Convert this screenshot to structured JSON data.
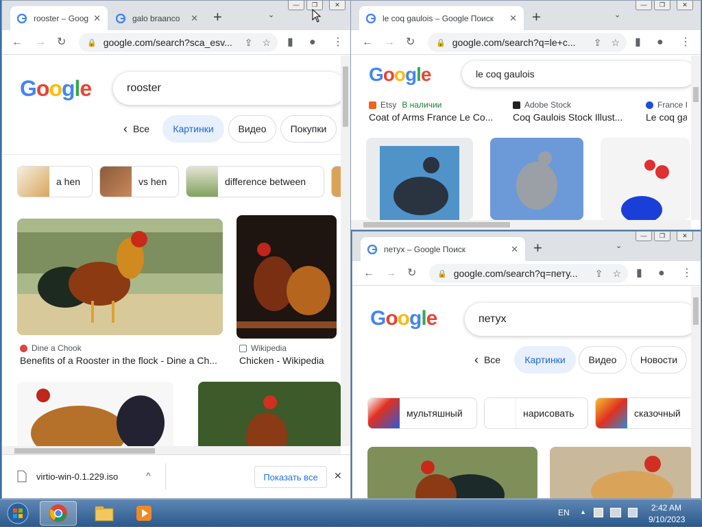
{
  "win1": {
    "tabs": [
      {
        "title": "rooster – Goog",
        "close": "✕"
      },
      {
        "title": "galo braanco",
        "close": "✕"
      }
    ],
    "new_tab": "+",
    "tab_menu": "⌄",
    "url": "google.com/search?sca_esv...",
    "query": "rooster",
    "chips": [
      "Все",
      "Картинки",
      "Видео",
      "Покупки"
    ],
    "related": [
      "a hen",
      "vs hen",
      "difference between"
    ],
    "results": [
      {
        "source": "Dine a Chook",
        "caption": "Benefits of a Rooster in the flock - Dine a Ch..."
      },
      {
        "source": "Wikipedia",
        "caption": "Chicken - Wikipedia"
      }
    ],
    "download": {
      "file": "virtio-win-0.1.229.iso",
      "show_all": "Показать все",
      "expand": "^",
      "close": "✕"
    }
  },
  "win2": {
    "tabs": [
      {
        "title": "le coq gaulois – Google Поиск",
        "close": "✕"
      }
    ],
    "new_tab": "+",
    "tab_menu": "⌄",
    "url": "google.com/search?q=le+c...",
    "query": "le coq gaulois",
    "results": [
      {
        "source": "Etsy",
        "badge": "В наличии",
        "caption": "Coat of Arms France Le Co..."
      },
      {
        "source": "Adobe Stock",
        "caption": "Coq Gaulois Stock Illust..."
      },
      {
        "source": "France I",
        "caption": "Le coq ga"
      }
    ]
  },
  "win3": {
    "tabs": [
      {
        "title": "петух – Google Поиск",
        "close": "✕"
      }
    ],
    "new_tab": "+",
    "tab_menu": "⌄",
    "url": "google.com/search?q=пету...",
    "query": "петух",
    "chips": [
      "Все",
      "Картинки",
      "Видео",
      "Новости"
    ],
    "related": [
      "мультяшный",
      "нарисовать",
      "сказочный"
    ]
  },
  "logo": {
    "l1": "G",
    "l2": "o",
    "l3": "o",
    "l4": "g",
    "l5": "l",
    "l6": "e"
  },
  "window_controls": {
    "minimize": "—",
    "restore": "❐",
    "close": "✕"
  },
  "icons": {
    "back": "←",
    "forward": "→",
    "reload": "↻",
    "share": "⇪",
    "star": "☆",
    "sidepanel": "▮",
    "profile": "●",
    "menu": "⋮",
    "lock": "🔒",
    "chip_back": "‹"
  },
  "taskbar": {
    "lang": "EN",
    "time": "2:42 AM",
    "date": "9/10/2023",
    "tray_arrow": "▲"
  },
  "colors": {
    "google_blue": "#4285f4",
    "google_red": "#ea4335",
    "google_yellow": "#fbbc05",
    "google_green": "#34a853",
    "chip_selected": "#e8f0fe",
    "taskbar": "#3f6e9f"
  }
}
